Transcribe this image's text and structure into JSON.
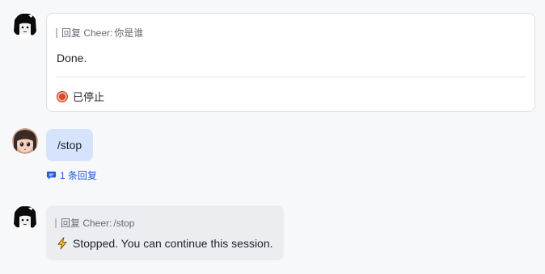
{
  "messages": [
    {
      "sender": "bot",
      "quote_prefix": "回复 Cheer:",
      "quote_text": "你是谁",
      "body": "Done.",
      "status_icon": "stop-circle-icon",
      "status_text": "已停止"
    },
    {
      "sender": "user",
      "body": "/stop",
      "reply_icon": "comment-icon",
      "reply_count_label": "1 条回复"
    },
    {
      "sender": "bot",
      "quote_prefix": "回复 Cheer:",
      "quote_text": "/stop",
      "body_icon": "lightning-icon",
      "body": "Stopped. You can continue this session."
    }
  ],
  "colors": {
    "page_bg": "#f7f8fa",
    "card_border": "#dee0e3",
    "user_bubble": "#d5e4fc",
    "bot_bubble": "#ebedf0",
    "link": "#245bdb",
    "stop_red": "#d9482b"
  }
}
